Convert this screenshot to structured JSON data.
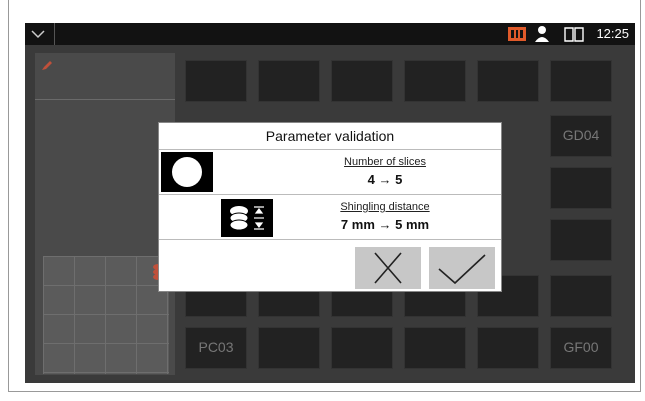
{
  "topbar": {
    "clock": "12:25",
    "icons": [
      "chevron-down-icon",
      "machine-status-icon",
      "user-icon",
      "book-icon"
    ],
    "status_color": "#e05a2a"
  },
  "dialog": {
    "title": "Parameter validation",
    "rows": [
      {
        "label": "Number of slices",
        "value": "4 → 5",
        "icon": "slice-count-icon"
      },
      {
        "label": "Shingling distance",
        "value": "7 mm → 5 mm",
        "icon": "shingling-icon"
      }
    ],
    "buttons": [
      "cancel-icon",
      "confirm-icon"
    ]
  },
  "tiles": {
    "codes": [
      "GD04",
      "PC03",
      "GF00"
    ]
  },
  "colors": {
    "accent": "#e05a2a",
    "background": "#3a3a3a",
    "tile": "#222222"
  }
}
